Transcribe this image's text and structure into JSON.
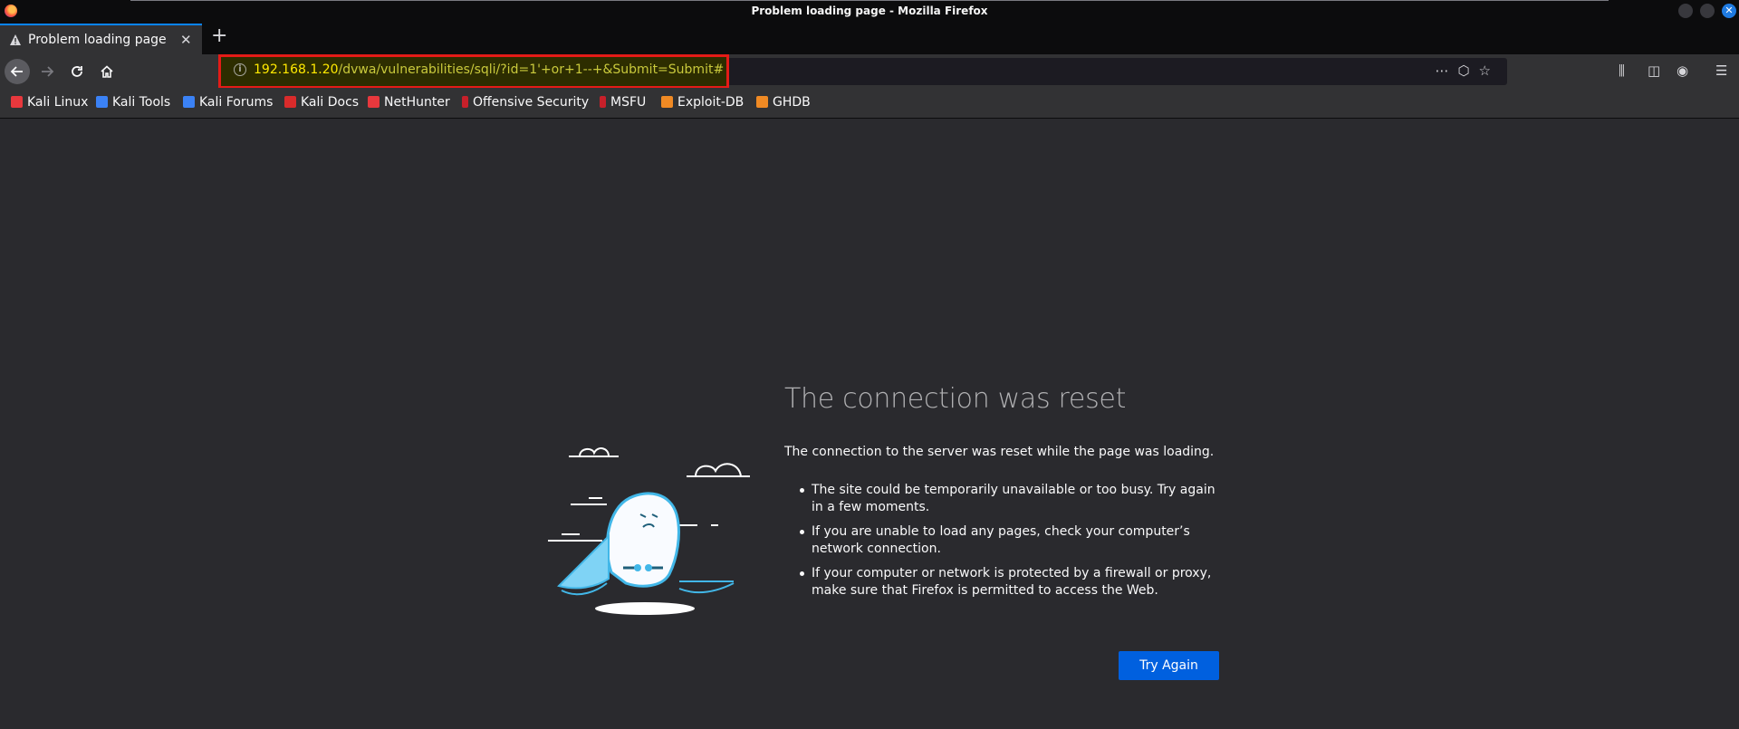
{
  "window": {
    "title": "Problem loading page - Mozilla Firefox"
  },
  "tab": {
    "title": "Problem loading page",
    "icon": "warning-icon"
  },
  "urlbar": {
    "host": "192.168.1.20",
    "path": "/dvwa/vulnerabilities/sqli/?id=1'+or+1--+&Submit=Submit#",
    "highlight_color": "#e41b17"
  },
  "bookmarks": [
    {
      "label": "Kali Linux",
      "color": "#e8383d"
    },
    {
      "label": "Kali Tools",
      "color": "#3b82f6"
    },
    {
      "label": "Kali Forums",
      "color": "#3b82f6"
    },
    {
      "label": "Kali Docs",
      "color": "#d92b2b"
    },
    {
      "label": "NetHunter",
      "color": "#e8383d"
    },
    {
      "label": "Offensive Security",
      "color": "#c7202a"
    },
    {
      "label": "MSFU",
      "color": "#c7202a"
    },
    {
      "label": "Exploit-DB",
      "color": "#f08a24"
    },
    {
      "label": "GHDB",
      "color": "#f08a24"
    }
  ],
  "error": {
    "title": "The connection was reset",
    "description": "The connection to the server was reset while the page was loading.",
    "items": [
      "The site could be temporarily unavailable or too busy. Try again in a few moments.",
      "If you are unable to load any pages, check your computer’s network connection.",
      "If your computer or network is protected by a firewall or proxy, make sure that Firefox is permitted to access the Web."
    ],
    "button": "Try Again"
  }
}
